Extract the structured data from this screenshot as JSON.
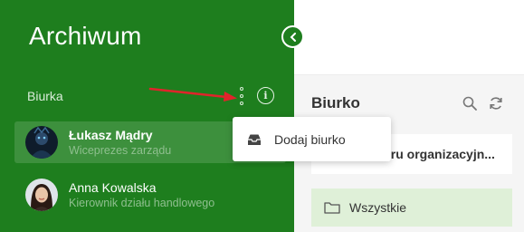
{
  "sidebar": {
    "title": "Archiwum",
    "section_label": "Biurka",
    "users": [
      {
        "name": "Łukasz Mądry",
        "role": "Wiceprezes zarządu",
        "active": true
      },
      {
        "name": "Anna Kowalska",
        "role": "Kierownik działu handlowego",
        "active": false
      }
    ]
  },
  "dropdown": {
    "items": [
      {
        "label": "Dodaj biurko",
        "icon": "inbox-tray-icon"
      }
    ]
  },
  "panel": {
    "title": "Biurko",
    "cards": [
      {
        "label": "eru organizacyjn..."
      },
      {
        "label": "Wszystkie",
        "icon": "folder-icon"
      }
    ]
  },
  "colors": {
    "sidebar_bg": "#1e7e1e",
    "active_card_bg": "#dff0d8",
    "annotation_arrow": "#e0242b"
  }
}
